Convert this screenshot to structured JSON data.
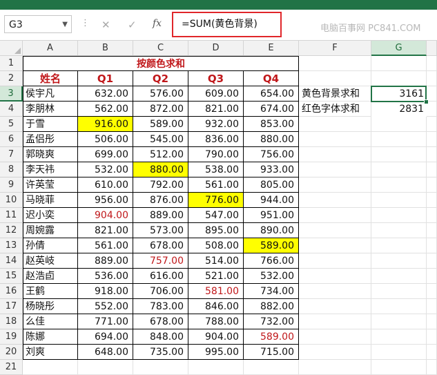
{
  "name_box": "G3",
  "formula_buttons": {
    "cancel": "✕",
    "confirm": "✓",
    "fx": "fx"
  },
  "formula": "=SUM(黄色背景)",
  "watermark_top": "电脑百事网 PC841.COM",
  "columns": [
    "A",
    "B",
    "C",
    "D",
    "E",
    "F",
    "G"
  ],
  "rows": [
    "1",
    "2",
    "3",
    "4",
    "5",
    "6",
    "7",
    "8",
    "9",
    "10",
    "11",
    "12",
    "13",
    "14",
    "15",
    "16",
    "17",
    "18",
    "19",
    "20",
    "21"
  ],
  "table_title": "按颜色求和",
  "headers": [
    "姓名",
    "Q1",
    "Q2",
    "Q3",
    "Q4"
  ],
  "data": [
    [
      "侯宇凡",
      "632.00",
      "576.00",
      "609.00",
      "654.00"
    ],
    [
      "李朋林",
      "562.00",
      "872.00",
      "821.00",
      "674.00"
    ],
    [
      "于雪",
      "916.00",
      "589.00",
      "932.00",
      "853.00"
    ],
    [
      "孟侣彤",
      "506.00",
      "545.00",
      "836.00",
      "880.00"
    ],
    [
      "郭晓爽",
      "699.00",
      "512.00",
      "790.00",
      "756.00"
    ],
    [
      "李天祎",
      "532.00",
      "880.00",
      "538.00",
      "933.00"
    ],
    [
      "许英莹",
      "610.00",
      "792.00",
      "561.00",
      "805.00"
    ],
    [
      "马晓菲",
      "956.00",
      "876.00",
      "776.00",
      "944.00"
    ],
    [
      "迟小奕",
      "904.00",
      "889.00",
      "547.00",
      "951.00"
    ],
    [
      "周婉露",
      "821.00",
      "573.00",
      "895.00",
      "890.00"
    ],
    [
      "孙倩",
      "561.00",
      "678.00",
      "508.00",
      "589.00"
    ],
    [
      "赵英岐",
      "889.00",
      "757.00",
      "514.00",
      "766.00"
    ],
    [
      "赵浩卣",
      "536.00",
      "616.00",
      "521.00",
      "532.00"
    ],
    [
      "王鹤",
      "918.00",
      "706.00",
      "581.00",
      "734.00"
    ],
    [
      "杨晓彤",
      "552.00",
      "783.00",
      "846.00",
      "882.00"
    ],
    [
      "么佳",
      "771.00",
      "678.00",
      "788.00",
      "732.00"
    ],
    [
      "陈娜",
      "694.00",
      "848.00",
      "904.00",
      "589.00"
    ],
    [
      "刘爽",
      "648.00",
      "735.00",
      "995.00",
      "715.00"
    ]
  ],
  "yellow_cells": [
    [
      2,
      1
    ],
    [
      5,
      2
    ],
    [
      7,
      3
    ],
    [
      10,
      4
    ]
  ],
  "red_cells": [
    [
      8,
      1
    ],
    [
      11,
      2
    ],
    [
      13,
      3
    ],
    [
      16,
      4
    ]
  ],
  "side_labels": [
    "黄色背景求和",
    "红色字体求和"
  ],
  "side_values": [
    "3161",
    "2831"
  ],
  "colors": {
    "excel_green": "#217346",
    "highlight_yellow": "#ffff00",
    "red_text": "#c0171a",
    "formula_box": "#e0262a"
  }
}
